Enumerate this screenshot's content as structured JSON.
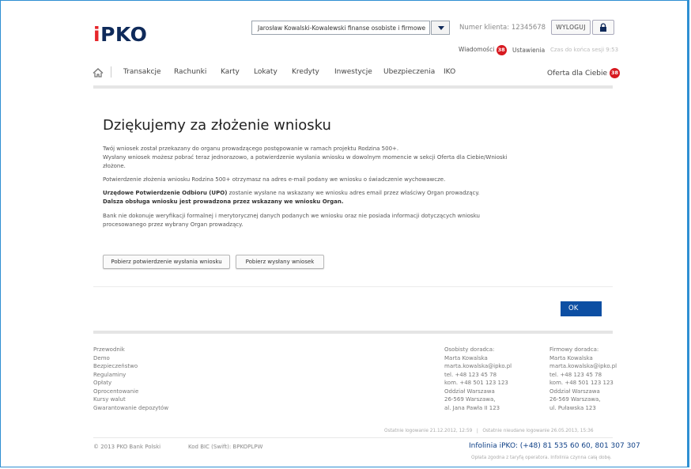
{
  "header": {
    "logo": {
      "icon_letter": "i",
      "text": "PKO"
    },
    "context_select": {
      "value": "Jarosław Kowalski-Kowalewski finanse osobiste i firmowe"
    },
    "client_number": {
      "label": "Numer klienta:",
      "value": "12345678"
    },
    "logout_label": "WYLOGUJ",
    "messages": {
      "label": "Wiadomości",
      "count": "38"
    },
    "settings_label": "Ustawienia",
    "session": {
      "label": "Czas do końca sesji",
      "value": "9:53"
    }
  },
  "nav": {
    "items": [
      "Transakcje",
      "Rachunki",
      "Karty",
      "Lokaty",
      "Kredyty",
      "Inwestycje",
      "Ubezpieczenia",
      "IKO"
    ],
    "offer": {
      "label": "Oferta dla Ciebie",
      "count": "38"
    }
  },
  "main": {
    "title": "Dziękujemy za złożenie wniosku",
    "p1": "Twój wniosek został przekazany do organu prowadzącego postępowanie w ramach projektu Rodzina 500+.",
    "p1b": "Wysłany wniosek możesz pobrać teraz jednorazowo, a potwierdzenie wysłania wniosku w dowolnym momencie w sekcji Oferta dla Ciebie/Wnioski złożone.",
    "p2": "Potwierdzenie złożenia wniosku Rodzina 500+ otrzymasz na adres e-mail podany we wniosku o świadczenie wychowawcze.",
    "p3_bold": "Urzędowe Potwierdzenie Odbioru (UPO)",
    "p3_rest": " zostanie wysłane na wskazany we wniosku adres email przez właściwy Organ prowadzący.",
    "p3_line2": "Dalsza obsługa wniosku jest prowadzona przez wskazany we wniosku Organ.",
    "p4": "Bank nie dokonuje weryfikacji formalnej i merytorycznej danych podanych we wniosku oraz nie posiada informacji dotyczących wniosku procesowanego przez wybrany Organ prowadzący.",
    "buttons": {
      "download_confirmation": "Pobierz potwierdzenie wysłania wniosku",
      "download_application": "Pobierz wysłany wniosek"
    },
    "ok_label": "OK"
  },
  "footer": {
    "links": [
      "Przewodnik",
      "Demo",
      "Bezpieczeństwo",
      "Regulaminy",
      "Opłaty",
      "Oprocentowanie",
      "Kursy walut",
      "Gwarantowanie depozytów"
    ],
    "personal_advisor": [
      "Osobisty doradca:",
      "Marta Kowalska",
      "marta.kowalska@ipko.pl",
      "tel. +48 123 45 78",
      "kom. +48 501 123 123",
      "Oddział Warszawa",
      "26-569 Warszawa,",
      "al. Jana Pawła II 123"
    ],
    "business_advisor": [
      "Firmowy doradca:",
      "Marta Kowalska",
      "marta.kowalska@ipko.pl",
      "tel. +48 123 45 78",
      "kom. +48 501 123 123",
      "Oddział Warszawa",
      "26-569 Warszawa,",
      "ul. Puławska 123"
    ],
    "last_login": "Ostatnie logowanie 21.12.2012, 12:59",
    "last_failed_login": "Ostatnie nieudane logowanie 26.05.2013, 15:36",
    "last_login_separator": "|",
    "copyright": "© 2013 PKO Bank Polski",
    "bic": "Kod BIC (Swift): BPKOPLPW",
    "infolinia": "Infolinia iPKO: (+48) 81 535 60 60, 801 307 307",
    "oplata": "Opłata zgodna z taryfą operatora. Infolinia czynna całą dobę."
  },
  "colors": {
    "brand_navy": "#0f2a5a",
    "accent_red": "#d71920",
    "ok_blue": "#0d4fa3",
    "frame_blue": "#2f8fd2"
  },
  "icons": {
    "home": "home-icon",
    "lock": "lock-icon",
    "dropdown": "chevron-down-icon"
  }
}
